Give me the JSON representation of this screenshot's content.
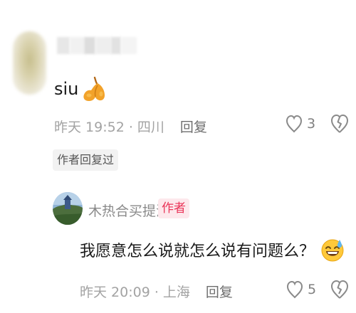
{
  "comment": {
    "text": "siu",
    "emoji_icon": "peach-emoji-icon",
    "timestamp": "昨天 19:52 · 四川",
    "reply_label": "回复",
    "like_count": "3",
    "author_replied_tag": "作者回复过"
  },
  "reply": {
    "username": "木热合买提江",
    "author_badge": "作者",
    "text": "我愿意怎么说就怎么说有问题么？",
    "emoji_icon": "sweat-smile-emoji-icon",
    "timestamp": "昨天 20:09 · 上海",
    "reply_label": "回复",
    "like_count": "5"
  },
  "colors": {
    "author_badge_bg": "#fde8ec",
    "author_badge_text": "#ea3559",
    "meta_text": "#a3a3a3",
    "body_text": "#1a1a1a"
  }
}
